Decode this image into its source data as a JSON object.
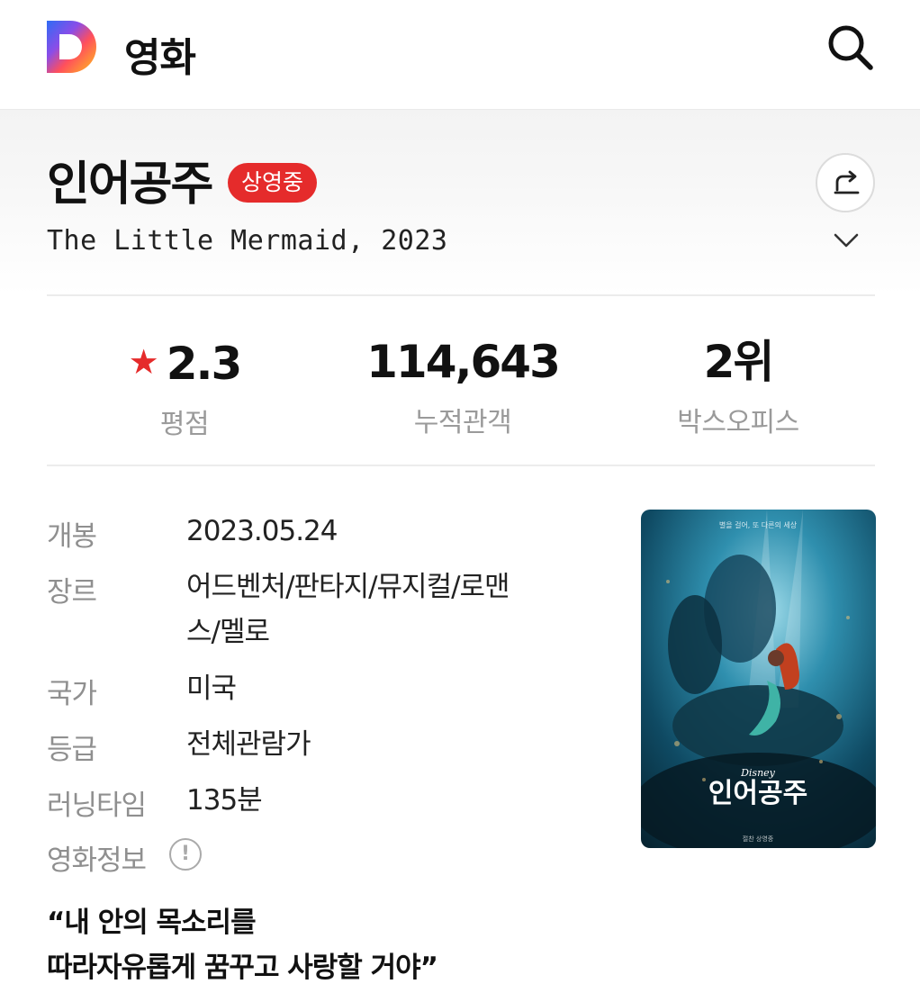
{
  "header": {
    "logo_letter": "D",
    "service_title": "영화"
  },
  "movie": {
    "title": "인어공주",
    "status_badge": "상영중",
    "original_title": "The Little Mermaid, 2023",
    "accent_color": "#e52b2b"
  },
  "stats": [
    {
      "value": "2.3",
      "label": "평점"
    },
    {
      "value": "114,643",
      "label": "누적관객"
    },
    {
      "value": "2위",
      "label": "박스오피스"
    }
  ],
  "info": [
    {
      "label": "개봉",
      "value": "2023.05.24"
    },
    {
      "label": "장르",
      "value_line1": "어드벤처/판타지/뮤지컬/로맨",
      "value_line2": "스/멜로"
    },
    {
      "label": "국가",
      "value": "미국"
    },
    {
      "label": "등급",
      "value": "전체관람가"
    },
    {
      "label": "러닝타임",
      "value": "135분"
    }
  ],
  "info_link": "영화정보",
  "poster": {
    "brand": "Disney",
    "title": "인어공주",
    "tagline_top": "별을 걸어, 또 다른의 세상",
    "bottom_text": "절찬 상영중"
  },
  "tagline": {
    "line1": "“내 안의 목소리를",
    "line2": "따라자유롭게 꿈꾸고 사랑할 거야”"
  }
}
